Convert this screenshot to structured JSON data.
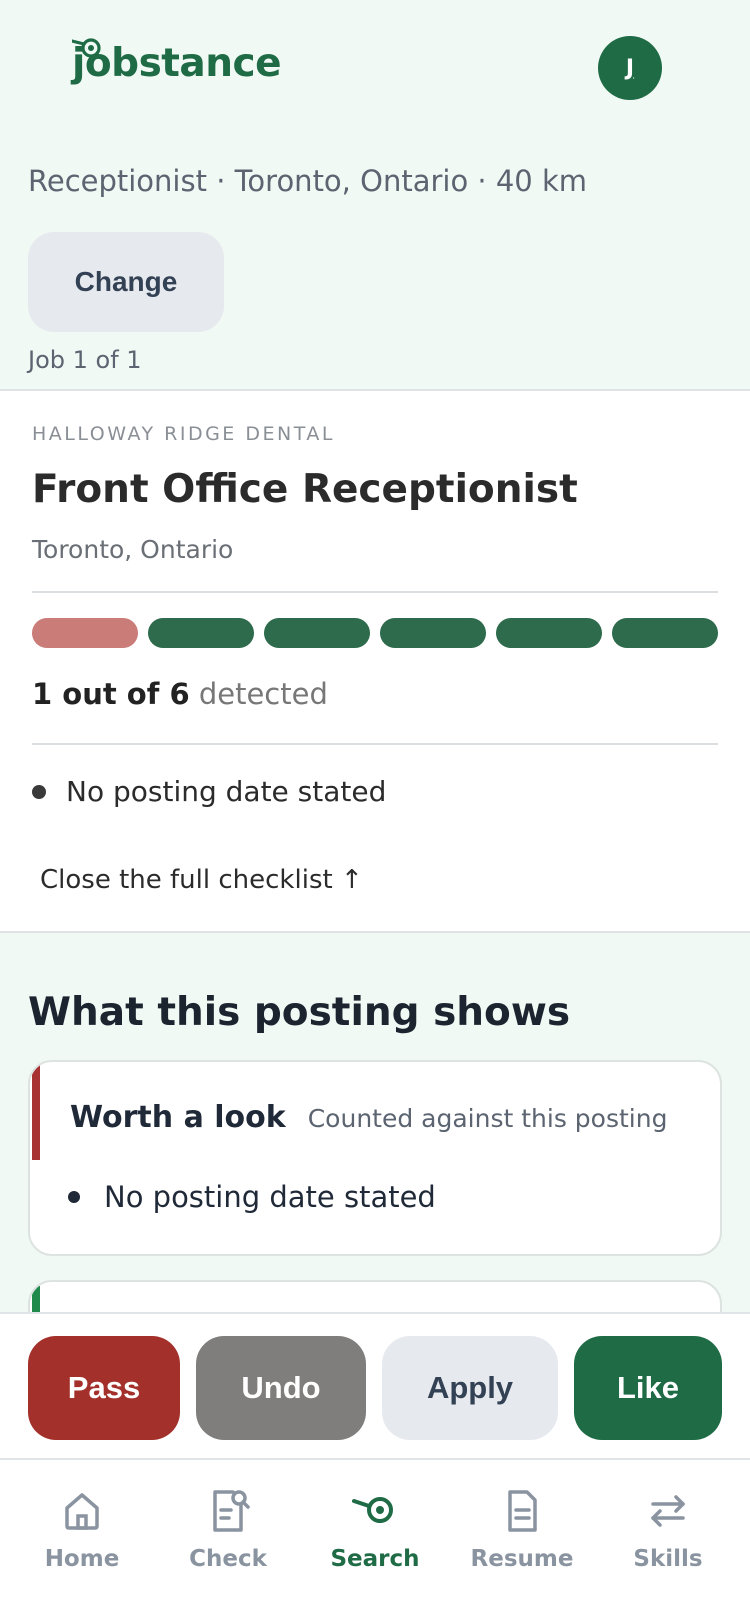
{
  "header": {
    "logo_text": "jobstance",
    "avatar_initial": "J"
  },
  "search": {
    "summary": "Receptionist · Toronto, Ontario · 40 km",
    "change_label": "Change",
    "job_count": "Job 1 of 1"
  },
  "job": {
    "company": "HALLOWAY RIDGE DENTAL",
    "title": "Front Office Receptionist",
    "location": "Toronto, Ontario",
    "checklist_bars": [
      {
        "state": "detected",
        "color": "#c97c78"
      },
      {
        "state": "clear",
        "color": "#2d6b4c"
      },
      {
        "state": "clear",
        "color": "#2d6b4c"
      },
      {
        "state": "clear",
        "color": "#2d6b4c"
      },
      {
        "state": "clear",
        "color": "#2d6b4c"
      },
      {
        "state": "clear",
        "color": "#2d6b4c"
      }
    ],
    "detected_count": "1 out of 6",
    "detected_suffix": "detected",
    "flags": [
      "No posting date stated"
    ],
    "close_checklist": "Close the full checklist ↑"
  },
  "shows": {
    "title": "What this posting shows",
    "look_label": "Worth a look",
    "look_sub": "Counted against this posting",
    "look_items": [
      "No posting date stated"
    ],
    "look_accent": "#a83232",
    "next_accent": "#1f8a4c"
  },
  "actions": {
    "pass": "Pass",
    "undo": "Undo",
    "apply": "Apply",
    "like": "Like"
  },
  "nav": {
    "items": [
      {
        "label": "Home",
        "icon": "home-icon",
        "active": false
      },
      {
        "label": "Check",
        "icon": "document-search-icon",
        "active": false
      },
      {
        "label": "Search",
        "icon": "search-target-icon",
        "active": true
      },
      {
        "label": "Resume",
        "icon": "document-icon",
        "active": false
      },
      {
        "label": "Skills",
        "icon": "swap-arrows-icon",
        "active": false
      }
    ]
  },
  "colors": {
    "brand": "#1f6b46",
    "pass": "#a3302a",
    "undo": "#807e7c",
    "page_bg": "#f1f9f4"
  }
}
